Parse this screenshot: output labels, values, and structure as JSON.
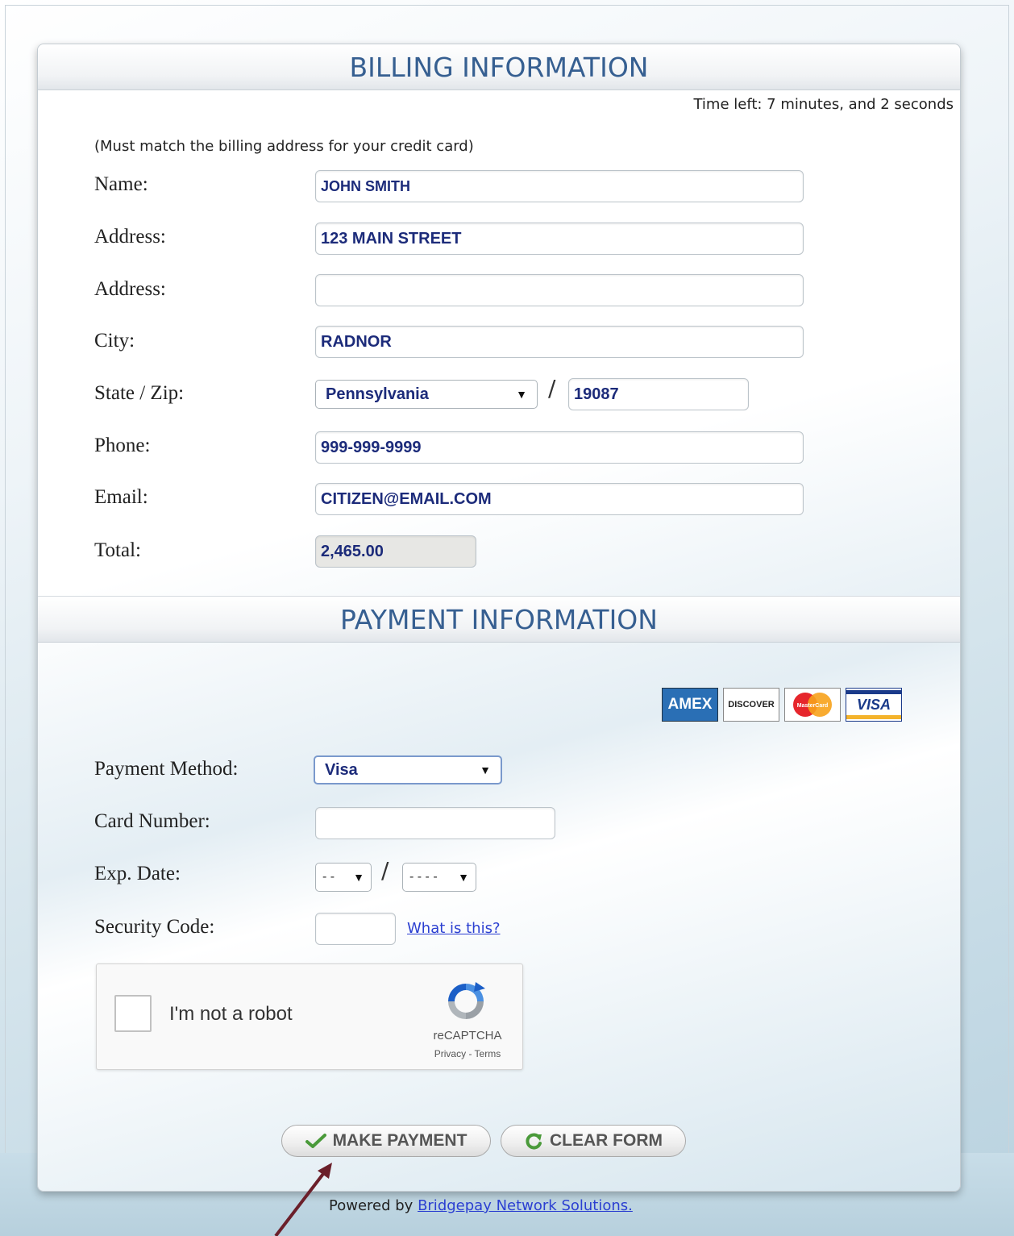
{
  "billing": {
    "title": "BILLING INFORMATION",
    "timer": "Time left: 7 minutes, and 2 seconds",
    "note": "(Must match the billing address for your credit card)",
    "name_label": "Name:",
    "name_value": "JOHN SMITH",
    "address_label": "Address:",
    "address_value": "123 MAIN STREET",
    "address2_label": "Address:",
    "address2_value": "",
    "city_label": "City:",
    "city_value": "RADNOR",
    "state_zip_label": "State / Zip:",
    "state_value": "Pennsylvania",
    "zip_value": "19087",
    "phone_label": "Phone:",
    "phone_value": "999-999-9999",
    "email_label": "Email:",
    "email_value": "CITIZEN@EMAIL.COM",
    "total_label": "Total:",
    "total_value": "2,465.00"
  },
  "payment": {
    "title": "PAYMENT INFORMATION",
    "cards": [
      "AMEX",
      "DISCOVER",
      "MasterCard",
      "VISA"
    ],
    "method_label": "Payment Method:",
    "method_value": "Visa",
    "card_number_label": "Card Number:",
    "card_number_value": "",
    "exp_label": "Exp. Date:",
    "exp_month": "- -",
    "exp_year": "- - - -",
    "security_label": "Security Code:",
    "security_value": "",
    "what_is_this": "What is this?"
  },
  "captcha": {
    "label": "I'm not a robot",
    "brand": "reCAPTCHA",
    "terms": "Privacy - Terms"
  },
  "buttons": {
    "make_payment": "MAKE PAYMENT",
    "clear_form": "CLEAR FORM"
  },
  "footer": {
    "prefix": "Powered by",
    "link": "Bridgepay Network Solutions."
  },
  "colors": {
    "header_text": "#365f91",
    "field_text": "#1c2b7a",
    "link": "#2b3fd1",
    "arrow": "#6b1f2a",
    "check": "#4a9a3a"
  }
}
